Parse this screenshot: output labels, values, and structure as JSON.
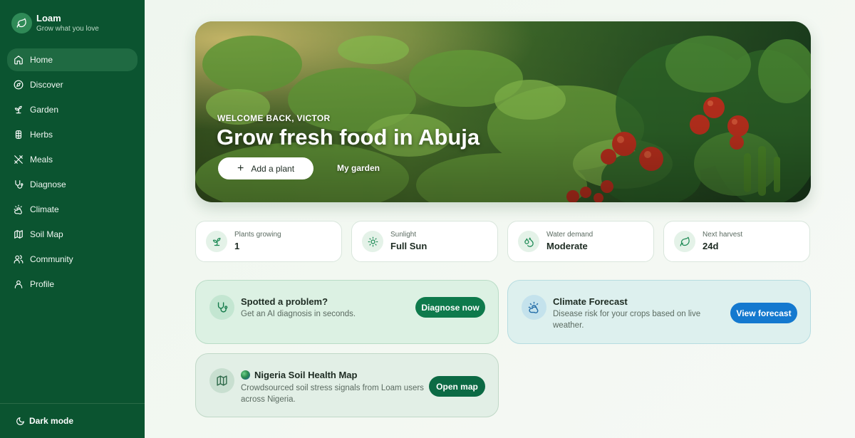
{
  "brand": {
    "name": "Loam",
    "tagline": "Grow what you love"
  },
  "sidebar": {
    "items": [
      {
        "label": "Home",
        "icon": "home-icon",
        "active": true
      },
      {
        "label": "Discover",
        "icon": "compass-icon"
      },
      {
        "label": "Garden",
        "icon": "sprout-icon"
      },
      {
        "label": "Herbs",
        "icon": "herb-icon"
      },
      {
        "label": "Meals",
        "icon": "utensils-icon"
      },
      {
        "label": "Diagnose",
        "icon": "stethoscope-icon"
      },
      {
        "label": "Climate",
        "icon": "sun-cloud-icon"
      },
      {
        "label": "Soil Map",
        "icon": "map-icon"
      },
      {
        "label": "Community",
        "icon": "users-icon"
      },
      {
        "label": "Profile",
        "icon": "user-icon"
      }
    ],
    "dark_mode_label": "Dark mode"
  },
  "hero": {
    "eyebrow": "WELCOME BACK, VICTOR",
    "title": "Grow fresh food in Abuja",
    "add_plant_label": "Add a plant",
    "my_garden_label": "My garden"
  },
  "stats": [
    {
      "label": "Plants growing",
      "value": "1",
      "icon": "sprout-icon"
    },
    {
      "label": "Sunlight",
      "value": "Full Sun",
      "icon": "sun-icon"
    },
    {
      "label": "Water demand",
      "value": "Moderate",
      "icon": "droplets-icon"
    },
    {
      "label": "Next harvest",
      "value": "24d",
      "icon": "leaf-icon"
    }
  ],
  "diagnose_card": {
    "title": "Spotted a problem?",
    "description": "Get an AI diagnosis in seconds.",
    "button": "Diagnose now",
    "icon": "stethoscope-icon"
  },
  "climate_card": {
    "title": "Climate Forecast",
    "description_line1": "Disease risk for your crops based on live",
    "description_line2": "weather.",
    "button": "View forecast",
    "icon": "sun-cloud-icon"
  },
  "soil_card": {
    "title": "Nigeria Soil Health Map",
    "description_line1": "Crowdsourced soil stress signals from Loam users",
    "description_line2": "across Nigeria.",
    "button": "Open map",
    "icon": "map-icon"
  },
  "colors": {
    "sidebar_bg": "#0b5430",
    "accent_green": "#0e7a4c",
    "accent_blue": "#1479cf"
  }
}
